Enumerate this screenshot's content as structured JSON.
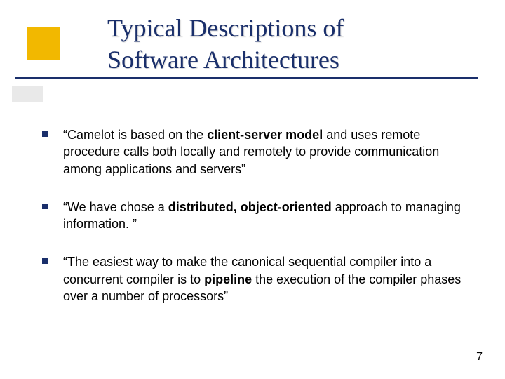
{
  "title_line1": "Typical Descriptions of",
  "title_line2": "Software Architectures",
  "bullets": [
    {
      "pre": "“Camelot is based on the ",
      "bold": "client-server model",
      "post": " and uses remote procedure calls both locally and remotely to provide communication among applications and servers”"
    },
    {
      "pre": "“We have chose a ",
      "bold": "distributed, object-oriented",
      "post": " approach to managing information. ”"
    },
    {
      "pre": "“The easiest way to make the canonical sequential compiler into a concurrent compiler is to ",
      "bold": "pipeline",
      "post": " the execution of the compiler phases over a number of processors”"
    }
  ],
  "page_number": "7"
}
